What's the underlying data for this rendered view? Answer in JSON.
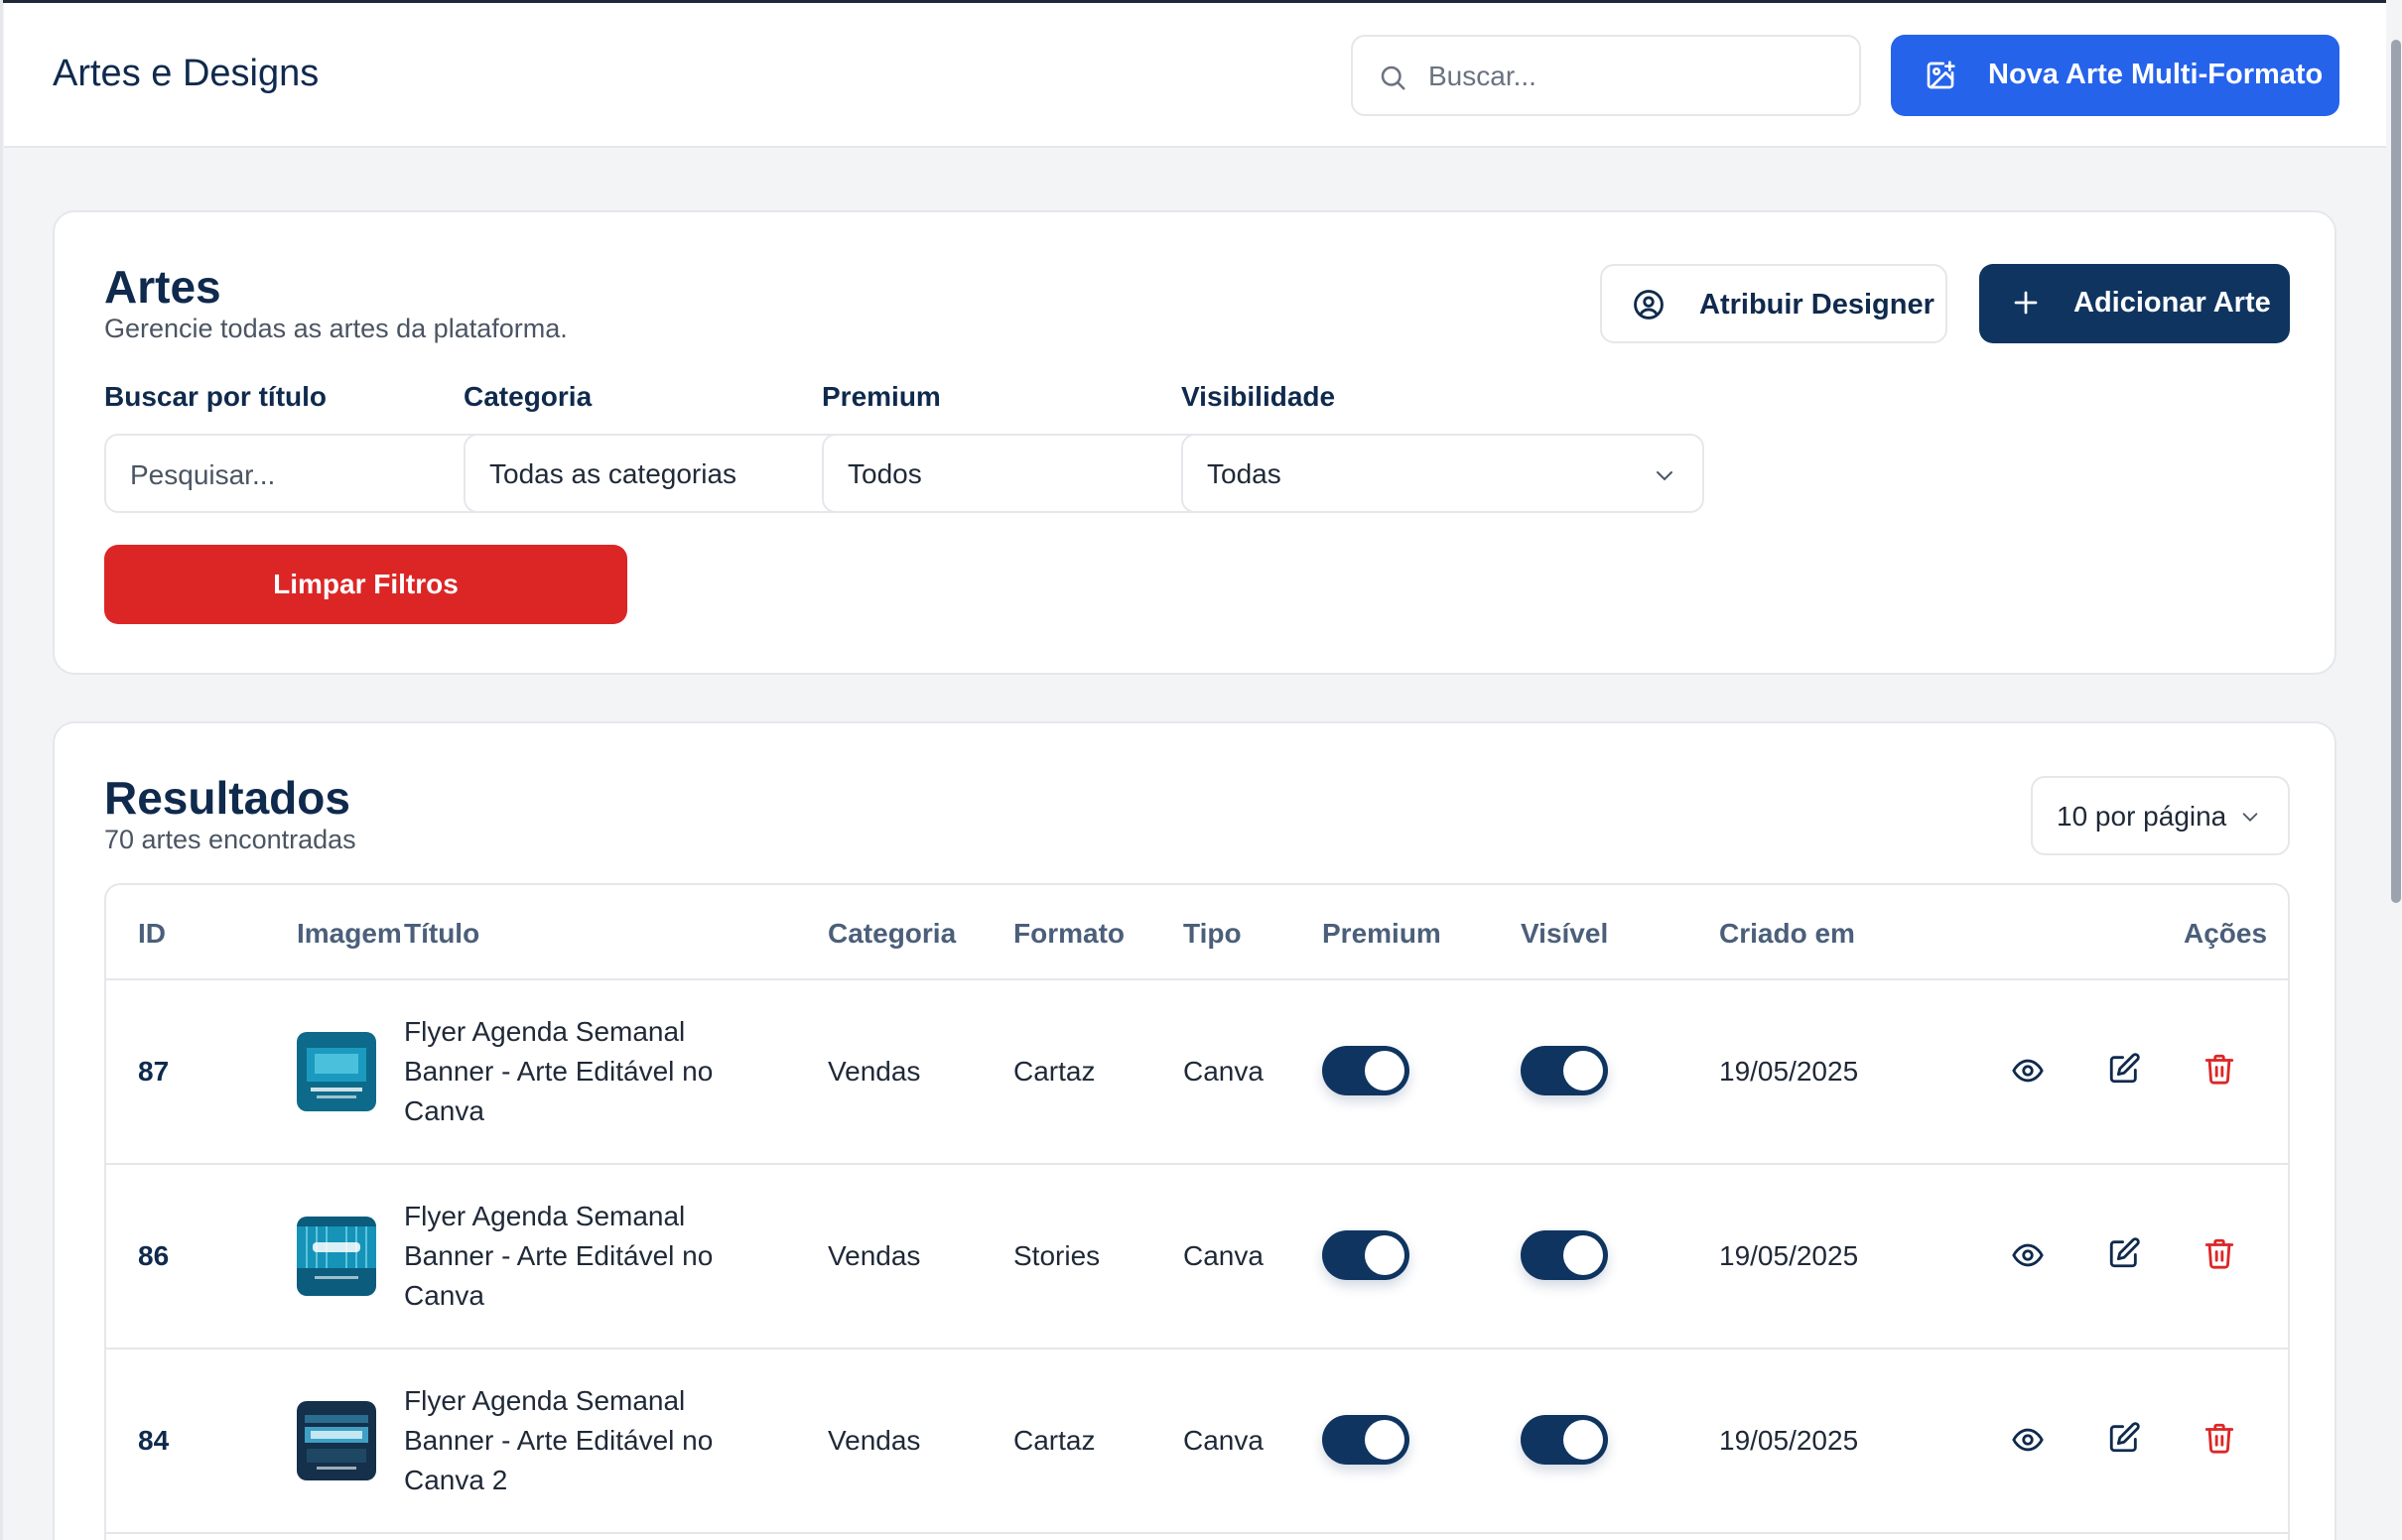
{
  "header": {
    "title": "Artes e Designs",
    "search_placeholder": "Buscar...",
    "multi_button": "Nova Arte Multi-Formato"
  },
  "filters": {
    "title": "Artes",
    "subtitle": "Gerencie todas as artes da plataforma.",
    "assign_button": "Atribuir Designer",
    "add_button": "Adicionar Arte",
    "search_label": "Buscar por título",
    "search_placeholder": "Pesquisar...",
    "category_label": "Categoria",
    "category_value": "Todas as categorias",
    "premium_label": "Premium",
    "premium_value": "Todos",
    "visibility_label": "Visibilidade",
    "visibility_value": "Todas",
    "clear_button": "Limpar Filtros"
  },
  "results": {
    "title": "Resultados",
    "count": "70 artes encontradas",
    "per_page": "10 por página",
    "columns": [
      "ID",
      "Imagem",
      "Título",
      "Categoria",
      "Formato",
      "Tipo",
      "Premium",
      "Visível",
      "Criado em",
      "Ações"
    ],
    "rows": [
      {
        "id": "87",
        "title_lines": [
          "Flyer Agenda Semanal",
          "Banner - Arte Editável no",
          "Canva"
        ],
        "category": "Vendas",
        "format": "Cartaz",
        "type": "Canva",
        "premium": true,
        "visible": true,
        "created": "19/05/2025",
        "thumb_color": "#0e6a8a"
      },
      {
        "id": "86",
        "title_lines": [
          "Flyer Agenda Semanal",
          "Banner - Arte Editável no",
          "Canva"
        ],
        "category": "Vendas",
        "format": "Stories",
        "type": "Canva",
        "premium": true,
        "visible": true,
        "created": "19/05/2025",
        "thumb_color": "#0b5c7d"
      },
      {
        "id": "84",
        "title_lines": [
          "Flyer Agenda Semanal",
          "Banner - Arte Editável no",
          "Canva 2"
        ],
        "category": "Vendas",
        "format": "Cartaz",
        "type": "Canva",
        "premium": true,
        "visible": true,
        "created": "19/05/2025",
        "thumb_color": "#14304a"
      }
    ]
  },
  "colors": {
    "primary_blue": "#2563eb",
    "navy": "#0f3460",
    "danger": "#dc2626",
    "text_dark": "#0f2a4d"
  },
  "icons": [
    "search-icon",
    "image-plus-icon",
    "user-circle-icon",
    "plus-icon",
    "chevron-down-icon",
    "eye-icon",
    "edit-icon",
    "trash-icon"
  ]
}
